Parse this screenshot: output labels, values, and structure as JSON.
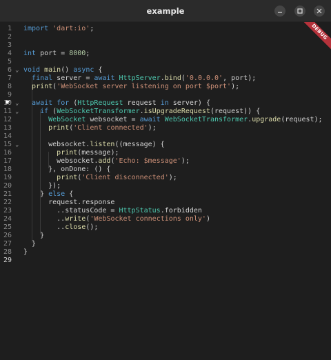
{
  "window": {
    "title": "example",
    "minimize_icon": "minimize-icon",
    "maximize_icon": "maximize-icon",
    "close_icon": "close-icon"
  },
  "banner": {
    "label": "DEBUG",
    "color": "#b5323b"
  },
  "colors": {
    "keyword": "#569cd6",
    "string": "#ce9178",
    "type": "#4ec9b0",
    "function": "#dcdcaa",
    "number": "#b5cea8",
    "variable": "#9cdcfe",
    "text": "#d4d4d4"
  },
  "editor": {
    "lines": [
      {
        "num": "1",
        "fold": "",
        "tokens": [
          [
            "k",
            "import"
          ],
          [
            "t",
            " "
          ],
          [
            "s",
            "'dart:io'"
          ],
          [
            "t",
            ";"
          ]
        ]
      },
      {
        "num": "2",
        "fold": "",
        "tokens": []
      },
      {
        "num": "3",
        "fold": "",
        "tokens": []
      },
      {
        "num": "4",
        "fold": "",
        "tokens": [
          [
            "k",
            "int"
          ],
          [
            "t",
            " port = "
          ],
          [
            "n",
            "8000"
          ],
          [
            "t",
            ";"
          ]
        ]
      },
      {
        "num": "5",
        "fold": "",
        "tokens": []
      },
      {
        "num": "6",
        "fold": "⌄",
        "tokens": [
          [
            "k",
            "void"
          ],
          [
            "t",
            " "
          ],
          [
            "f",
            "main"
          ],
          [
            "t",
            "() "
          ],
          [
            "k",
            "async"
          ],
          [
            "t",
            " {"
          ]
        ]
      },
      {
        "num": "7",
        "fold": "",
        "tokens": [
          [
            "t",
            "  "
          ],
          [
            "k",
            "final"
          ],
          [
            "t",
            " server = "
          ],
          [
            "k",
            "await"
          ],
          [
            "t",
            " "
          ],
          [
            "c",
            "HttpServer"
          ],
          [
            "t",
            "."
          ],
          [
            "f",
            "bind"
          ],
          [
            "t",
            "("
          ],
          [
            "s",
            "'0.0.0.0'"
          ],
          [
            "t",
            ", port);"
          ]
        ]
      },
      {
        "num": "8",
        "fold": "",
        "tokens": [
          [
            "t",
            "  "
          ],
          [
            "f",
            "print"
          ],
          [
            "t",
            "("
          ],
          [
            "s",
            "'WebSocket server listening on port $port'"
          ],
          [
            "t",
            ");"
          ]
        ]
      },
      {
        "num": "9",
        "fold": "",
        "tokens": []
      },
      {
        "num": "10",
        "fold": "⌄",
        "tokens": [
          [
            "t",
            "  "
          ],
          [
            "k",
            "await"
          ],
          [
            "t",
            " "
          ],
          [
            "k",
            "for"
          ],
          [
            "t",
            " ("
          ],
          [
            "c",
            "HttpRequest"
          ],
          [
            "t",
            " request "
          ],
          [
            "k",
            "in"
          ],
          [
            "t",
            " server) {"
          ]
        ]
      },
      {
        "num": "11",
        "fold": "⌄",
        "tokens": [
          [
            "t",
            "    "
          ],
          [
            "k",
            "if"
          ],
          [
            "t",
            " ("
          ],
          [
            "c",
            "WebSocketTransformer"
          ],
          [
            "t",
            "."
          ],
          [
            "f",
            "isUpgradeRequest"
          ],
          [
            "t",
            "(request)) {"
          ]
        ]
      },
      {
        "num": "12",
        "fold": "",
        "tokens": [
          [
            "t",
            "      "
          ],
          [
            "c",
            "WebSocket"
          ],
          [
            "t",
            " websocket = "
          ],
          [
            "k",
            "await"
          ],
          [
            "t",
            " "
          ],
          [
            "c",
            "WebSocketTransformer"
          ],
          [
            "t",
            "."
          ],
          [
            "f",
            "upgrade"
          ],
          [
            "t",
            "(request);"
          ]
        ]
      },
      {
        "num": "13",
        "fold": "",
        "tokens": [
          [
            "t",
            "      "
          ],
          [
            "f",
            "print"
          ],
          [
            "t",
            "("
          ],
          [
            "s",
            "'Client connected'"
          ],
          [
            "t",
            ");"
          ]
        ]
      },
      {
        "num": "14",
        "fold": "",
        "tokens": []
      },
      {
        "num": "15",
        "fold": "⌄",
        "tokens": [
          [
            "t",
            "      websocket."
          ],
          [
            "f",
            "listen"
          ],
          [
            "t",
            "((message) {"
          ]
        ]
      },
      {
        "num": "16",
        "fold": "",
        "tokens": [
          [
            "t",
            "        "
          ],
          [
            "f",
            "print"
          ],
          [
            "t",
            "(message);"
          ]
        ]
      },
      {
        "num": "17",
        "fold": "",
        "tokens": [
          [
            "t",
            "        websocket."
          ],
          [
            "f",
            "add"
          ],
          [
            "t",
            "("
          ],
          [
            "s",
            "'Echo: $message'"
          ],
          [
            "t",
            ");"
          ]
        ]
      },
      {
        "num": "18",
        "fold": "",
        "tokens": [
          [
            "t",
            "      }, onDone: () {"
          ]
        ]
      },
      {
        "num": "19",
        "fold": "",
        "tokens": [
          [
            "t",
            "        "
          ],
          [
            "f",
            "print"
          ],
          [
            "t",
            "("
          ],
          [
            "s",
            "'Client disconnected'"
          ],
          [
            "t",
            ");"
          ]
        ]
      },
      {
        "num": "20",
        "fold": "",
        "tokens": [
          [
            "t",
            "      });"
          ]
        ]
      },
      {
        "num": "21",
        "fold": "",
        "tokens": [
          [
            "t",
            "    } "
          ],
          [
            "k",
            "else"
          ],
          [
            "t",
            " {"
          ]
        ]
      },
      {
        "num": "22",
        "fold": "",
        "tokens": [
          [
            "t",
            "      request.response"
          ]
        ]
      },
      {
        "num": "23",
        "fold": "",
        "tokens": [
          [
            "t",
            "        ..statusCode = "
          ],
          [
            "c",
            "HttpStatus"
          ],
          [
            "t",
            ".forbidden"
          ]
        ]
      },
      {
        "num": "24",
        "fold": "",
        "tokens": [
          [
            "t",
            "        .."
          ],
          [
            "f",
            "write"
          ],
          [
            "t",
            "("
          ],
          [
            "s",
            "'WebSocket connections only'"
          ],
          [
            "t",
            ")"
          ]
        ]
      },
      {
        "num": "25",
        "fold": "",
        "tokens": [
          [
            "t",
            "        .."
          ],
          [
            "f",
            "close"
          ],
          [
            "t",
            "();"
          ]
        ]
      },
      {
        "num": "26",
        "fold": "",
        "tokens": [
          [
            "t",
            "    }"
          ]
        ]
      },
      {
        "num": "27",
        "fold": "",
        "tokens": [
          [
            "t",
            "  }"
          ]
        ]
      },
      {
        "num": "28",
        "fold": "",
        "tokens": [
          [
            "t",
            "}"
          ]
        ]
      },
      {
        "num": "29",
        "fold": "",
        "tokens": []
      }
    ],
    "active_line": "29"
  }
}
